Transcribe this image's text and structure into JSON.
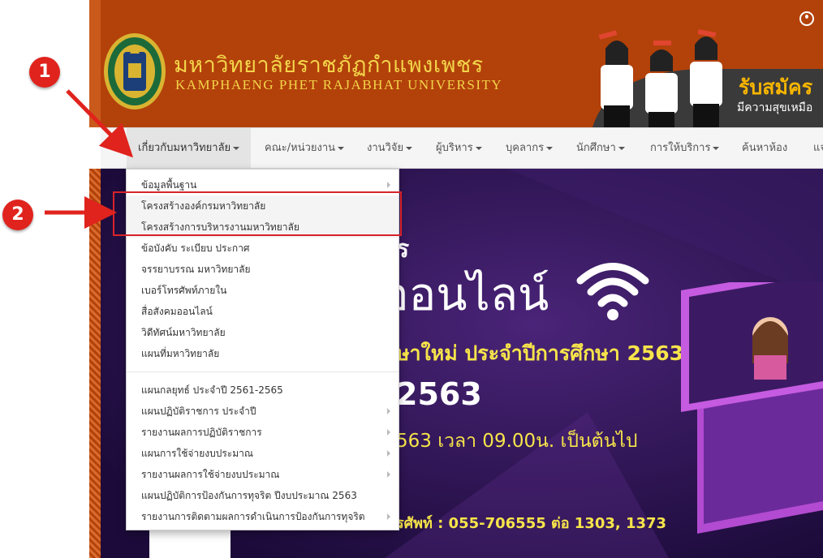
{
  "header": {
    "university_th": "มหาวิทยาลัยราชภัฏกำแพงเพชร",
    "university_en": "KAMPHAENG PHET RAJABHAT UNIVERSITY",
    "ad_title": "รับสมัคร",
    "ad_subtitle": "มีความสุขเหมือ",
    "colors": {
      "header_bg": "#b3410a",
      "title_color": "#f3d54a"
    }
  },
  "nav": {
    "items": [
      {
        "label": "เกี่ยวกับมหาวิทยาลัย"
      },
      {
        "label": "คณะ/หน่วยงาน"
      },
      {
        "label": "งานวิจัย"
      },
      {
        "label": "ผู้บริหาร"
      },
      {
        "label": "บุคลากร"
      },
      {
        "label": "นักศึกษา"
      },
      {
        "label": "การให้บริการ"
      },
      {
        "label": "ค้นหาห้อง"
      },
      {
        "label": "แจ"
      }
    ]
  },
  "dropdown": {
    "group1": [
      "ข้อมูลพื้นฐาน",
      "โครงสร้างองค์กรมหาวิทยาลัย",
      "โครงสร้างการบริหารงานมหาวิทยาลัย",
      "ข้อบังคับ ระเบียบ ประกาศ",
      "จรรยาบรรณ มหาวิทยาลัย",
      "เบอร์โทรศัพท์ภายใน",
      "สื่อสังคมออนไลน์",
      "วิดีทัศน์มหาวิทยาลัย",
      "แผนที่มหาวิทยาลัย"
    ],
    "group2": [
      "แผนกลยุทธ์ ประจำปี 2561-2565",
      "แผนปฏิบัติราชการ ประจำปี",
      "รายงานผลการปฏิบัติราชการ",
      "แผนการใช้จ่ายงบประมาณ",
      "รายงานผลการใช้จ่ายงบประมาณ",
      "แผนปฏิบัติการป้องกันการทุจริต ปีงบประมาณ 2563",
      "รายงานการติดตามผลการดำเนินการป้องกันการทุจริต"
    ]
  },
  "hero": {
    "line_q": "ร",
    "line1": "ออนไลน์",
    "line2": "ษาใหม่ ประจำปีการศึกษา 2563",
    "line3": "2563",
    "line4": "563 เวลา 09.00น. เป็นต้นไป",
    "line5": "รศัพท์ : 055-706555 ต่อ 1303, 1373"
  },
  "callouts": {
    "one": "1",
    "two": "2"
  },
  "colors": {
    "accent": "#d8232a",
    "hero_bg": "#2a1452",
    "hero_yellow": "#f6e44a"
  }
}
